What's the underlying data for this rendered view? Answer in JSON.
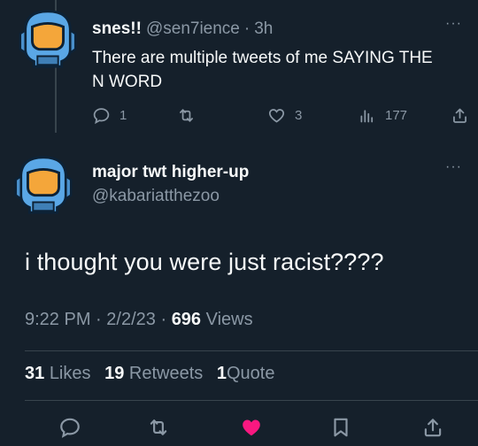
{
  "reply": {
    "name": "snes!!",
    "handle": "@sen7ience",
    "separator": "·",
    "time": "3h",
    "text": "There are multiple tweets of me SAYING THE N WORD",
    "more": "···",
    "reply_count": "1",
    "like_count": "3",
    "view_count": "177"
  },
  "main": {
    "name": "major twt higher-up",
    "handle": "@kabariatthezoo",
    "more": "···",
    "text": "i thought you were just racist????",
    "time": "9:22 PM",
    "date": "2/2/23",
    "separator": "·",
    "views_count": "696",
    "views_label": "Views"
  },
  "stats": {
    "likes_count": "31",
    "likes_label": "Likes",
    "retweets_count": "19",
    "retweets_label": "Retweets",
    "quotes_count": "1",
    "quotes_label": "Quote"
  },
  "icons": {
    "reply": "reply-icon",
    "retweet": "retweet-icon",
    "like": "heart-icon",
    "views": "views-icon",
    "share": "share-icon",
    "bookmark": "bookmark-icon"
  },
  "colors": {
    "background": "#15202b",
    "muted_text": "#8b98a5",
    "liked_heart": "#f91880",
    "helmet_blue": "#5aa7e6",
    "visor_orange": "#f4a63a"
  }
}
